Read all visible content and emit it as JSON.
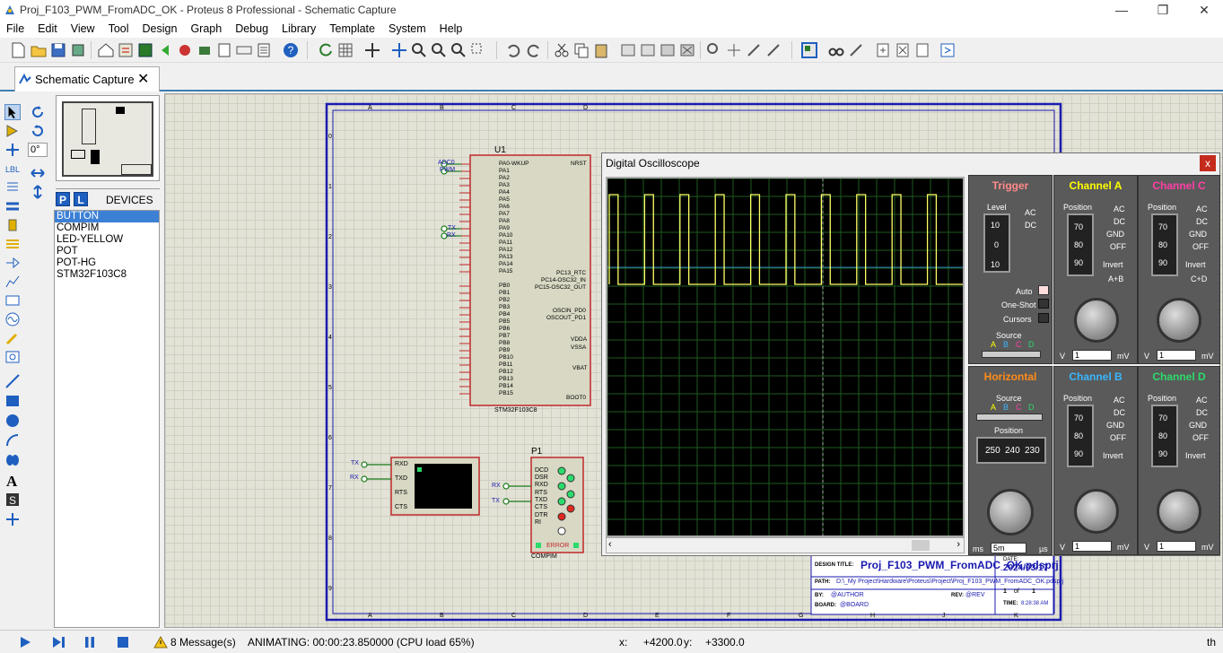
{
  "window": {
    "title": "Proj_F103_PWM_FromADC_OK - Proteus 8 Professional - Schematic Capture",
    "minimize_icon": "minimize-icon",
    "maximize_icon": "restore-icon",
    "close_icon": "close-icon"
  },
  "menu": [
    "File",
    "Edit",
    "View",
    "Tool",
    "Design",
    "Graph",
    "Debug",
    "Library",
    "Template",
    "System",
    "Help"
  ],
  "tab": {
    "label": "Schematic Capture",
    "close": "✕"
  },
  "rotation": "0°",
  "devices": {
    "header": "DEVICES",
    "p_label": "P",
    "l_label": "L",
    "items": [
      "BUTTON",
      "COMPIM",
      "LED-YELLOW",
      "POT",
      "POT-HG",
      "STM32F103C8"
    ],
    "selected": 0
  },
  "schematic": {
    "chip_ref": "U1",
    "chip_part": "STM32F103C8",
    "chip_pins_left": [
      "PA0-WKUP",
      "PA1",
      "PA2",
      "PA3",
      "PA4",
      "PA5",
      "PA6",
      "PA7",
      "PA8",
      "PA9",
      "PA10",
      "PA11",
      "PA12",
      "PA13",
      "PA14",
      "PA15",
      "",
      "PB0",
      "PB1",
      "PB2",
      "PB3",
      "PB4",
      "PB5",
      "PB6",
      "PB7",
      "PB8",
      "PB9",
      "PB10",
      "PB11",
      "PB12",
      "PB13",
      "PB14",
      "PB15"
    ],
    "chip_pins_right": [
      "NRST",
      "PC13_RTC",
      "PC14-OSC32_IN",
      "PC15-OSC32_OUT",
      "OSCIN_PD0",
      "OSCOUT_PD1",
      "VDDA",
      "VSSA",
      "VBAT",
      "BOOT0"
    ],
    "nets": {
      "adc0": "ADC0",
      "pwm": "PWM",
      "tx": "TX",
      "rx": "RX"
    },
    "terminal_pins": [
      "RXD",
      "TXD",
      "RTS",
      "CTS"
    ],
    "compim_ref": "P1",
    "compim_part": "COMPIM",
    "compim_pins": [
      "DCD",
      "DSR",
      "RXD",
      "RTS",
      "TXD",
      "CTS",
      "DTR",
      "RI"
    ],
    "compim_error": "ERROR",
    "title_block": {
      "design_title_label": "DESIGN TITLE:",
      "design_title": "Proj_F103_PWM_FromADC_OK.pdsprj",
      "date_label": "DATE:",
      "date": "2024/03/17",
      "path_label": "PATH:",
      "path": "D:\\_My Project\\Hardware\\Proteus\\Project\\Proj_F103_PWM_FromADC_OK.pdsprj",
      "by_label": "BY:",
      "by": "@AUTHOR",
      "rev_label": "REV:",
      "rev": "@REV",
      "page": "1",
      "of": "of",
      "pages": "1",
      "board_label": "BOARD:",
      "board": "@BOARD",
      "time_label": "TIME:",
      "time": "8:28:38 AM"
    },
    "col_letters": [
      "A",
      "B",
      "C",
      "D",
      "E",
      "F",
      "G",
      "H",
      "J",
      "K"
    ],
    "row_numbers": [
      "0",
      "1",
      "2",
      "3",
      "4",
      "5",
      "6",
      "7",
      "8",
      "9"
    ]
  },
  "oscilloscope": {
    "title": "Digital Oscilloscope",
    "close": "x",
    "trigger": {
      "title": "Trigger",
      "level_label": "Level",
      "level_ticks": [
        "10",
        "0",
        "10"
      ],
      "ac": "AC",
      "dc": "DC",
      "auto": "Auto",
      "one_shot": "One-Shot",
      "cursors": "Cursors",
      "source": "Source",
      "source_opts": [
        "A",
        "B",
        "C",
        "D"
      ]
    },
    "horizontal": {
      "title": "Horizontal",
      "source": "Source",
      "source_opts": [
        "A",
        "B",
        "C",
        "D"
      ],
      "position_label": "Position",
      "position_values": [
        "250",
        "240",
        "230"
      ],
      "unit_ms": "ms",
      "unit_us": "µs",
      "value": "5m",
      "scale": [
        "0.5",
        "0.2",
        "0.1",
        "50",
        "20",
        "10",
        "5",
        "2",
        "1",
        "0.5",
        "1",
        "2",
        "5",
        "10",
        "20",
        "50",
        "100",
        "200"
      ]
    },
    "channels": [
      {
        "name": "Channel A",
        "color": "#ffff00",
        "position_ticks": [
          "70",
          "80",
          "90"
        ],
        "ac": "AC",
        "dc": "DC",
        "gnd": "GND",
        "off": "OFF",
        "invert": "Invert",
        "extra": "A+B",
        "unit_v": "V",
        "unit_mv": "mV",
        "value": "1"
      },
      {
        "name": "Channel B",
        "color": "#39b6ff",
        "position_ticks": [
          "70",
          "80",
          "90"
        ],
        "ac": "AC",
        "dc": "DC",
        "gnd": "GND",
        "off": "OFF",
        "invert": "Invert",
        "extra": "",
        "unit_v": "V",
        "unit_mv": "mV",
        "value": "1"
      },
      {
        "name": "Channel C",
        "color": "#ff3fa6",
        "position_ticks": [
          "70",
          "80",
          "90"
        ],
        "ac": "AC",
        "dc": "DC",
        "gnd": "GND",
        "off": "OFF",
        "invert": "Invert",
        "extra": "C+D",
        "unit_v": "V",
        "unit_mv": "mV",
        "value": "1"
      },
      {
        "name": "Channel D",
        "color": "#2bdb6b",
        "position_ticks": [
          "70",
          "80",
          "90"
        ],
        "ac": "AC",
        "dc": "DC",
        "gnd": "GND",
        "off": "OFF",
        "invert": "Invert",
        "extra": "",
        "unit_v": "V",
        "unit_mv": "mV",
        "value": "1"
      }
    ],
    "knob_scale": [
      "0.5",
      "0.2",
      "0.1",
      "50",
      "20",
      "10",
      "5",
      "2",
      "1",
      "0.5",
      "1",
      "2",
      "5",
      "10",
      "20"
    ]
  },
  "status": {
    "messages": "8 Message(s)",
    "animating": "ANIMATING: 00:00:23.850000 (CPU load 65%)",
    "x_label": "x:",
    "x_val": "+4200.0",
    "y_label": "y:",
    "y_val": "+3300.0",
    "unit": "th"
  },
  "colors": {
    "trace": "#ffff66",
    "trigger_title": "#ff8a8a",
    "horizontal_title": "#ff8c1a",
    "chip_fill": "#d8d8c4",
    "chip_border": "#c0282a",
    "border_frame": "#1a1ab0",
    "accent": "#3c80d6"
  }
}
